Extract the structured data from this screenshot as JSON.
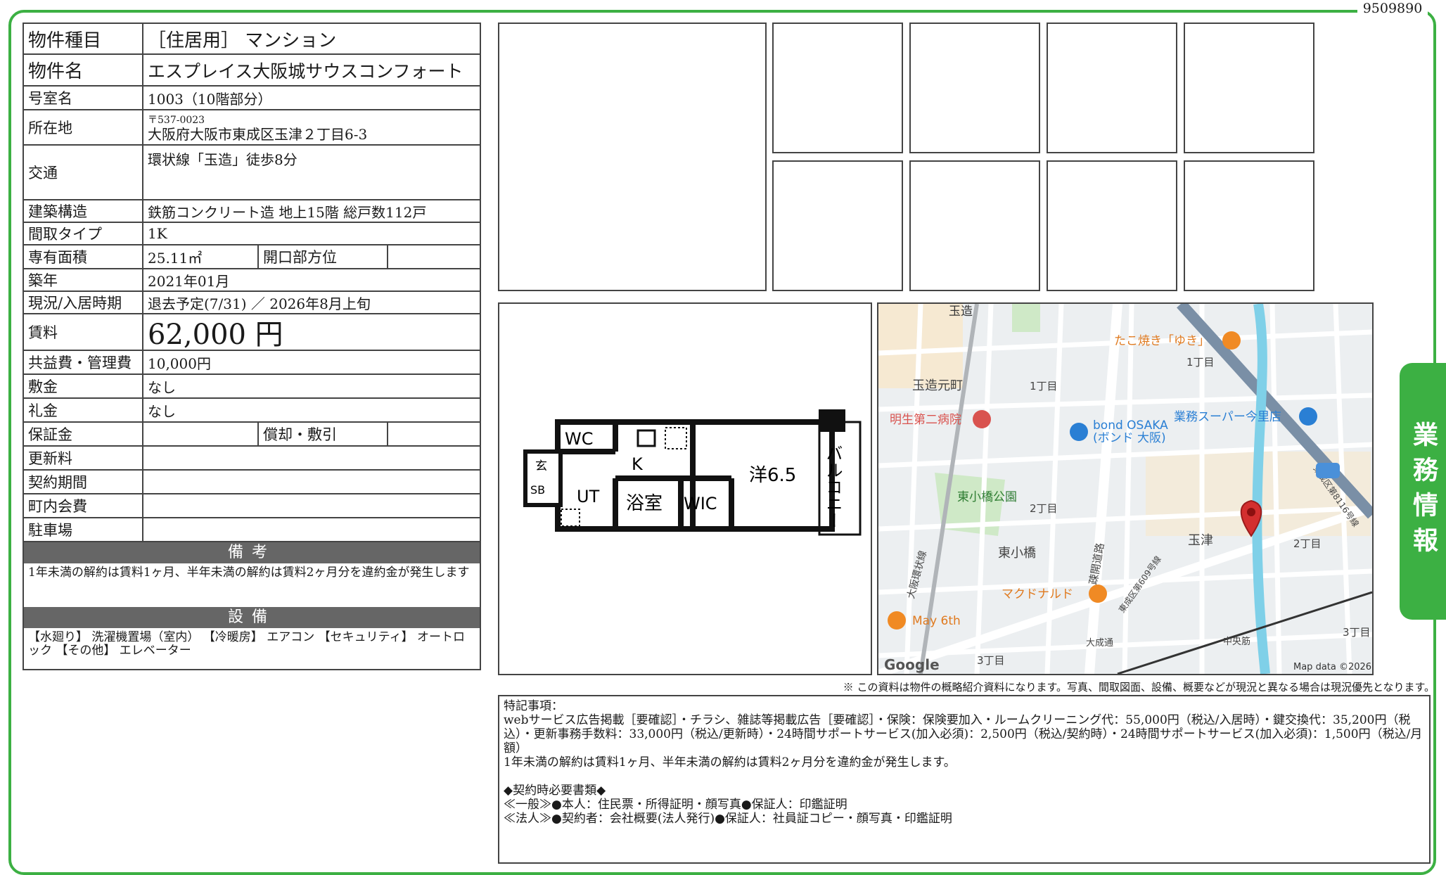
{
  "doc_id": "9509890",
  "side_tab": "業務情報",
  "property": {
    "rows": [
      {
        "label": "物件種目",
        "value": "［住居用］ マンション"
      },
      {
        "label": "物件名",
        "value": "エスプレイス大阪城サウスコンフォート"
      },
      {
        "label": "号室名",
        "value": "1003（10階部分）"
      },
      {
        "label": "所在地",
        "postal": "〒537-0023",
        "value": "大阪府大阪市東成区玉津２丁目6-3"
      },
      {
        "label": "交通",
        "value": "環状線「玉造」徒歩8分"
      },
      {
        "label": "建築構造",
        "value": "鉄筋コンクリート造 地上15階 総戸数112戸"
      },
      {
        "label": "間取タイプ",
        "value": "1K"
      },
      {
        "label": "専有面積",
        "value": "25.11㎡",
        "sub_label": "開口部方位",
        "sub_value": ""
      },
      {
        "label": "築年",
        "value": "2021年01月"
      },
      {
        "label": "現況/入居時期",
        "value": "退去予定(7/31) ／ 2026年8月上旬"
      },
      {
        "label": "賃料",
        "value": "62,000 円"
      },
      {
        "label": "共益費・管理費",
        "value": "10,000円"
      },
      {
        "label": "敷金",
        "value": "なし"
      },
      {
        "label": "礼金",
        "value": "なし"
      },
      {
        "label": "保証金",
        "value": "",
        "sub_label": "償却・敷引",
        "sub_value": ""
      },
      {
        "label": "更新料",
        "value": ""
      },
      {
        "label": "契約期間",
        "value": ""
      },
      {
        "label": "町内会費",
        "value": ""
      },
      {
        "label": "駐車場",
        "value": ""
      }
    ],
    "remarks_header": "備考",
    "remarks": "1年未満の解約は賃料1ヶ月、半年未満の解約は賃料2ヶ月分を違約金が発生します",
    "equipment_header": "設備",
    "equipment": "【水廻り】 洗濯機置場（室内） 【冷暖房】 エアコン 【セキュリティ】 オートロック 【その他】 エレベーター"
  },
  "floorplan": {
    "rooms": {
      "wc": "WC",
      "k": "K",
      "genkan": "玄",
      "sb": "SB",
      "ut": "UT",
      "bath": "浴室",
      "wic": "WIC",
      "western": "洋6.5",
      "balcony": "バルコニー"
    }
  },
  "map": {
    "labels": {
      "station": "玉造",
      "takoyaki": "たこ焼き「ゆき」",
      "chome1a": "1丁目",
      "chome1b": "1丁目",
      "tamatsukuri_moto": "玉造元町",
      "hospital": "明生第二病院",
      "bond": "bond OSAKA",
      "bond_sub": "(ボンド 大阪)",
      "super": "業務スーパー今里店",
      "park": "東小橋公園",
      "chome2a": "2丁目",
      "chome2b": "2丁目",
      "higashiobase": "東小橋",
      "tamatsu": "玉津",
      "mcd": "マクドナルド",
      "may6": "May 6th",
      "chome3a": "3丁目",
      "chome3b": "3丁目",
      "route308": "308",
      "kanjo": "大阪環状線",
      "shinyakura": "疎開道路",
      "daiseido": "大成通",
      "chuo": "中央筋",
      "route116": "東成区第8116号線",
      "route609": "東成区第609号線",
      "google": "Google",
      "mapdata": "Map data ©2026"
    }
  },
  "disclaimer": "※ この資料は物件の概略紹介資料になります。写真、間取図面、設備、概要などが現況と異なる場合は現況優先となります。",
  "special_notes": "特記事項：\nwebサービス広告掲載［要確認］・チラシ、雑誌等掲載広告［要確認］・保険：保険要加入・ルームクリーニング代：55,000円（税込/入居時）・鍵交換代：35,200円（税込）・更新事務手数料：33,000円（税込/更新時）・24時間サポートサービス(加入必須)：2,500円（税込/契約時）・24時間サポートサービス(加入必須)：1,500円（税込/月額）\n1年未満の解約は賃料1ヶ月、半年未満の解約は賃料2ヶ月分を違約金が発生します。\n\n◆契約時必要書類◆\n≪一般≫●本人：住民票・所得証明・顔写真●保証人：印鑑証明\n≪法人≫●契約者：会社概要(法人発行)●保証人：社員証コピー・顔写真・印鑑証明",
  "colors": {
    "accent": "#3cb043",
    "section_header": "#666666",
    "map_pin": "#d32f2f",
    "food_poi": "#f08a24"
  }
}
